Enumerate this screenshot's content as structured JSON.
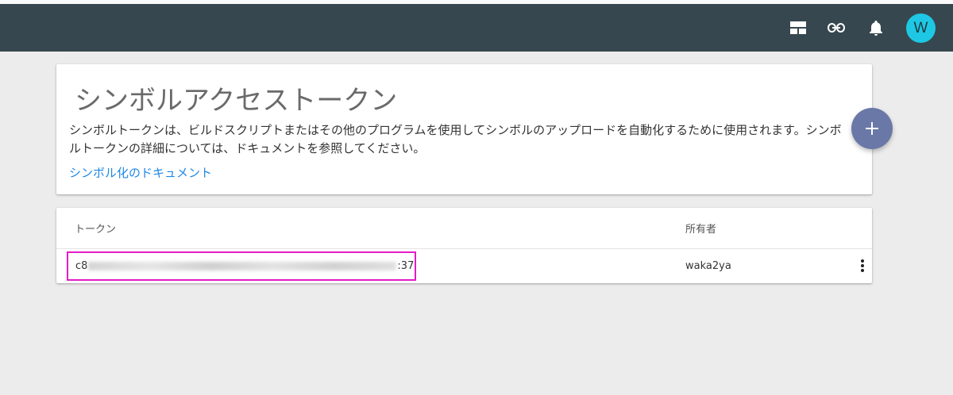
{
  "topbar": {
    "icons": [
      "layout-icon",
      "link-icon",
      "bell-icon"
    ],
    "avatar_letter": "W",
    "background": "#37474f",
    "avatar_color": "#1ec8e4"
  },
  "header": {
    "title": "シンボルアクセストークン",
    "description": "シンボルトークンは、ビルドスクリプトまたはその他のプログラムを使用してシンボルのアップロードを自動化するために使用されます。シンボルトークンの詳細については、ドキュメントを参照してください。",
    "doc_link": "シンボル化のドキュメント",
    "fab_label": "+"
  },
  "table": {
    "columns": [
      "トークン",
      "所有者"
    ],
    "rows": [
      {
        "token_prefix": "c8",
        "token_suffix": ":37",
        "owner": "waka2ya"
      }
    ]
  },
  "colors": {
    "link": "#1e88e5",
    "fab": "#6a78a8",
    "highlight": "#e31cc8"
  }
}
